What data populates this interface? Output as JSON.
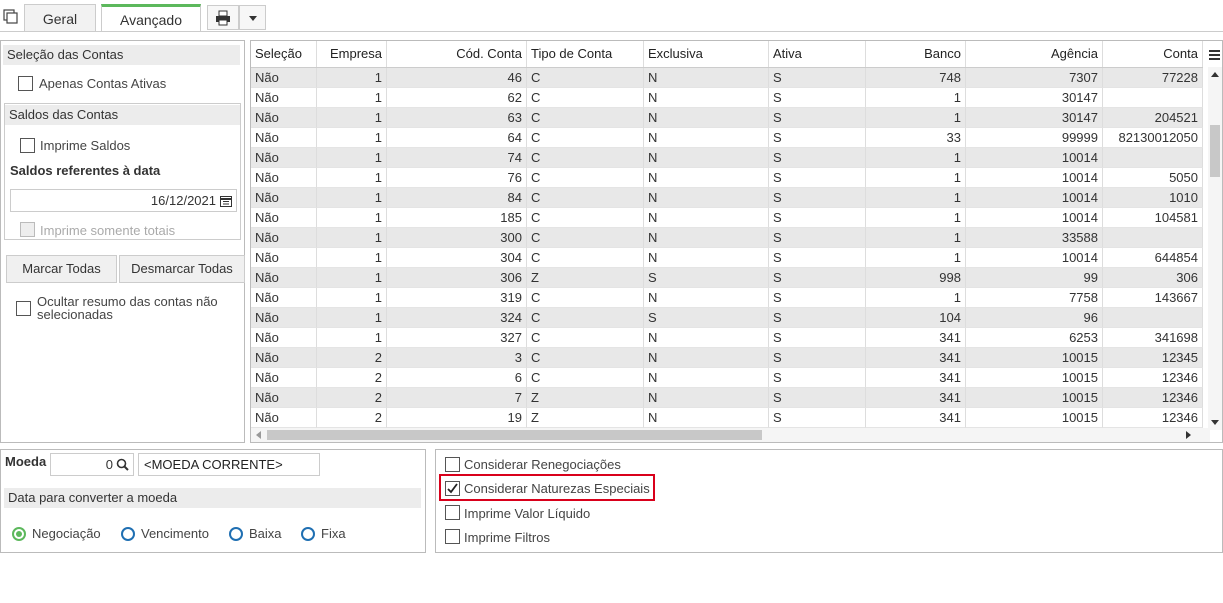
{
  "tabs": [
    "Geral",
    "Avançado"
  ],
  "toolbar": {
    "print_icon": "printer-icon",
    "dropdown_icon": "chevron-down-icon",
    "copy_icon": "copy-icon"
  },
  "left": {
    "selecao_title": "Seleção das Contas",
    "apenas_ativas": "Apenas Contas Ativas",
    "saldos_title": "Saldos das Contas",
    "imprime_saldos": "Imprime Saldos",
    "saldos_data_label": "Saldos referentes à data",
    "data_value": "16/12/2021",
    "imprime_totais": "Imprime somente totais",
    "marcar": "Marcar Todas",
    "desmarcar": "Desmarcar Todas",
    "ocultar": "Ocultar resumo das contas não selecionadas"
  },
  "grid": {
    "columns": [
      "Seleção",
      "Empresa",
      "Cód. Conta",
      "Tipo de Conta",
      "Exclusiva",
      "Ativa",
      "Banco",
      "Agência",
      "Conta"
    ],
    "rows": [
      [
        "Não",
        "1",
        "46",
        "C",
        "N",
        "S",
        "748",
        "7307",
        "77228"
      ],
      [
        "Não",
        "1",
        "62",
        "C",
        "N",
        "S",
        "1",
        "30147",
        ""
      ],
      [
        "Não",
        "1",
        "63",
        "C",
        "N",
        "S",
        "1",
        "30147",
        "204521"
      ],
      [
        "Não",
        "1",
        "64",
        "C",
        "N",
        "S",
        "33",
        "99999",
        "82130012050"
      ],
      [
        "Não",
        "1",
        "74",
        "C",
        "N",
        "S",
        "1",
        "10014",
        ""
      ],
      [
        "Não",
        "1",
        "76",
        "C",
        "N",
        "S",
        "1",
        "10014",
        "5050"
      ],
      [
        "Não",
        "1",
        "84",
        "C",
        "N",
        "S",
        "1",
        "10014",
        "1010"
      ],
      [
        "Não",
        "1",
        "185",
        "C",
        "N",
        "S",
        "1",
        "10014",
        "104581"
      ],
      [
        "Não",
        "1",
        "300",
        "C",
        "N",
        "S",
        "1",
        "33588",
        ""
      ],
      [
        "Não",
        "1",
        "304",
        "C",
        "N",
        "S",
        "1",
        "10014",
        "644854"
      ],
      [
        "Não",
        "1",
        "306",
        "Z",
        "S",
        "S",
        "998",
        "99",
        "306"
      ],
      [
        "Não",
        "1",
        "319",
        "C",
        "N",
        "S",
        "1",
        "7758",
        "143667"
      ],
      [
        "Não",
        "1",
        "324",
        "C",
        "S",
        "S",
        "104",
        "96",
        ""
      ],
      [
        "Não",
        "1",
        "327",
        "C",
        "N",
        "S",
        "341",
        "6253",
        "341698"
      ],
      [
        "Não",
        "2",
        "3",
        "C",
        "N",
        "S",
        "341",
        "10015",
        "12345"
      ],
      [
        "Não",
        "2",
        "6",
        "C",
        "N",
        "S",
        "341",
        "10015",
        "12346"
      ],
      [
        "Não",
        "2",
        "7",
        "Z",
        "N",
        "S",
        "341",
        "10015",
        "12346"
      ],
      [
        "Não",
        "2",
        "19",
        "Z",
        "N",
        "S",
        "341",
        "10015",
        "12346"
      ]
    ]
  },
  "moeda": {
    "label": "Moeda",
    "code": "0",
    "name": "<MOEDA CORRENTE>",
    "data_title": "Data para converter a moeda",
    "options": [
      "Negociação",
      "Vencimento",
      "Baixa",
      "Fixa"
    ],
    "selected": "Negociação"
  },
  "options": {
    "renegociacoes": "Considerar Renegociações",
    "naturezas": "Considerar Naturezas Especiais",
    "valor_liquido": "Imprime Valor Líquido",
    "filtros": "Imprime Filtros"
  },
  "colors": {
    "accent": "#5cb85c",
    "highlight": "#d9001b",
    "radio": "#1f6fb2"
  }
}
